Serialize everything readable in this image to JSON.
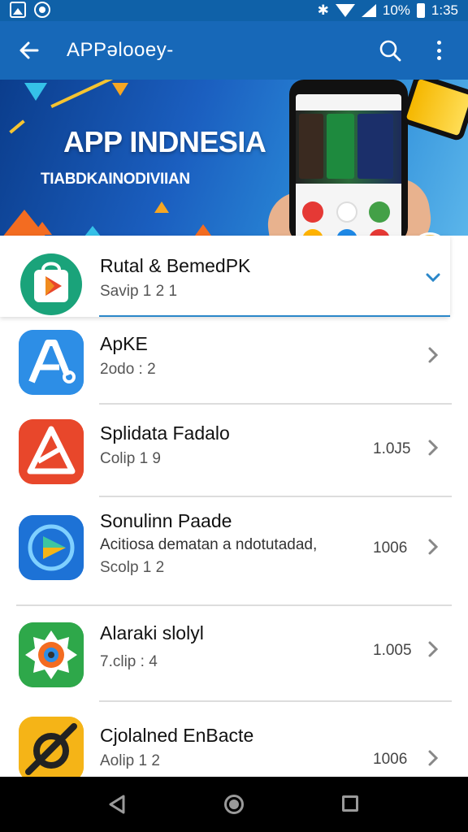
{
  "status": {
    "battery": "10%",
    "time": "1:35"
  },
  "appbar": {
    "title": "APPəlooey-"
  },
  "banner": {
    "headline": "APP INDNESIA",
    "subheadline": "TIABDKAINODIVIIAN"
  },
  "apps": [
    {
      "name": "Rutal & BemedPK",
      "meta": "Savip 1 2 1",
      "size": "",
      "icon": "play-store-icon",
      "accent": "#1aa37a"
    },
    {
      "name": "ApKE",
      "meta": "2odo : 2",
      "size": "",
      "icon": "letter-a-icon",
      "accent": "#2d8ee6"
    },
    {
      "name": "Splidata Fadalo",
      "meta": "Colip 1 9",
      "size": "1.0J5",
      "icon": "triangle-a-icon",
      "accent": "#e8472b"
    },
    {
      "name": "Sonulinn Paade",
      "meta": "Scolp 1 2",
      "description": "Acitiosa dematan a ndotutadad,",
      "size": "1006",
      "icon": "play-arrow-icon",
      "accent": "#1d72d6"
    },
    {
      "name": "Alaraki slolyl",
      "meta": "7.clip : 4",
      "size": "1.005",
      "icon": "gear-badge-icon",
      "accent": "#2ea84a"
    },
    {
      "name": "Cjolalned EnBacte",
      "meta": "Aolip 1 2",
      "size": "1006",
      "icon": "slashed-gear-icon",
      "accent": "#f5b417"
    }
  ],
  "colors": {
    "primary": "#1768b8",
    "statusbar": "#0f61a8",
    "selected_line": "#2a87c9"
  }
}
